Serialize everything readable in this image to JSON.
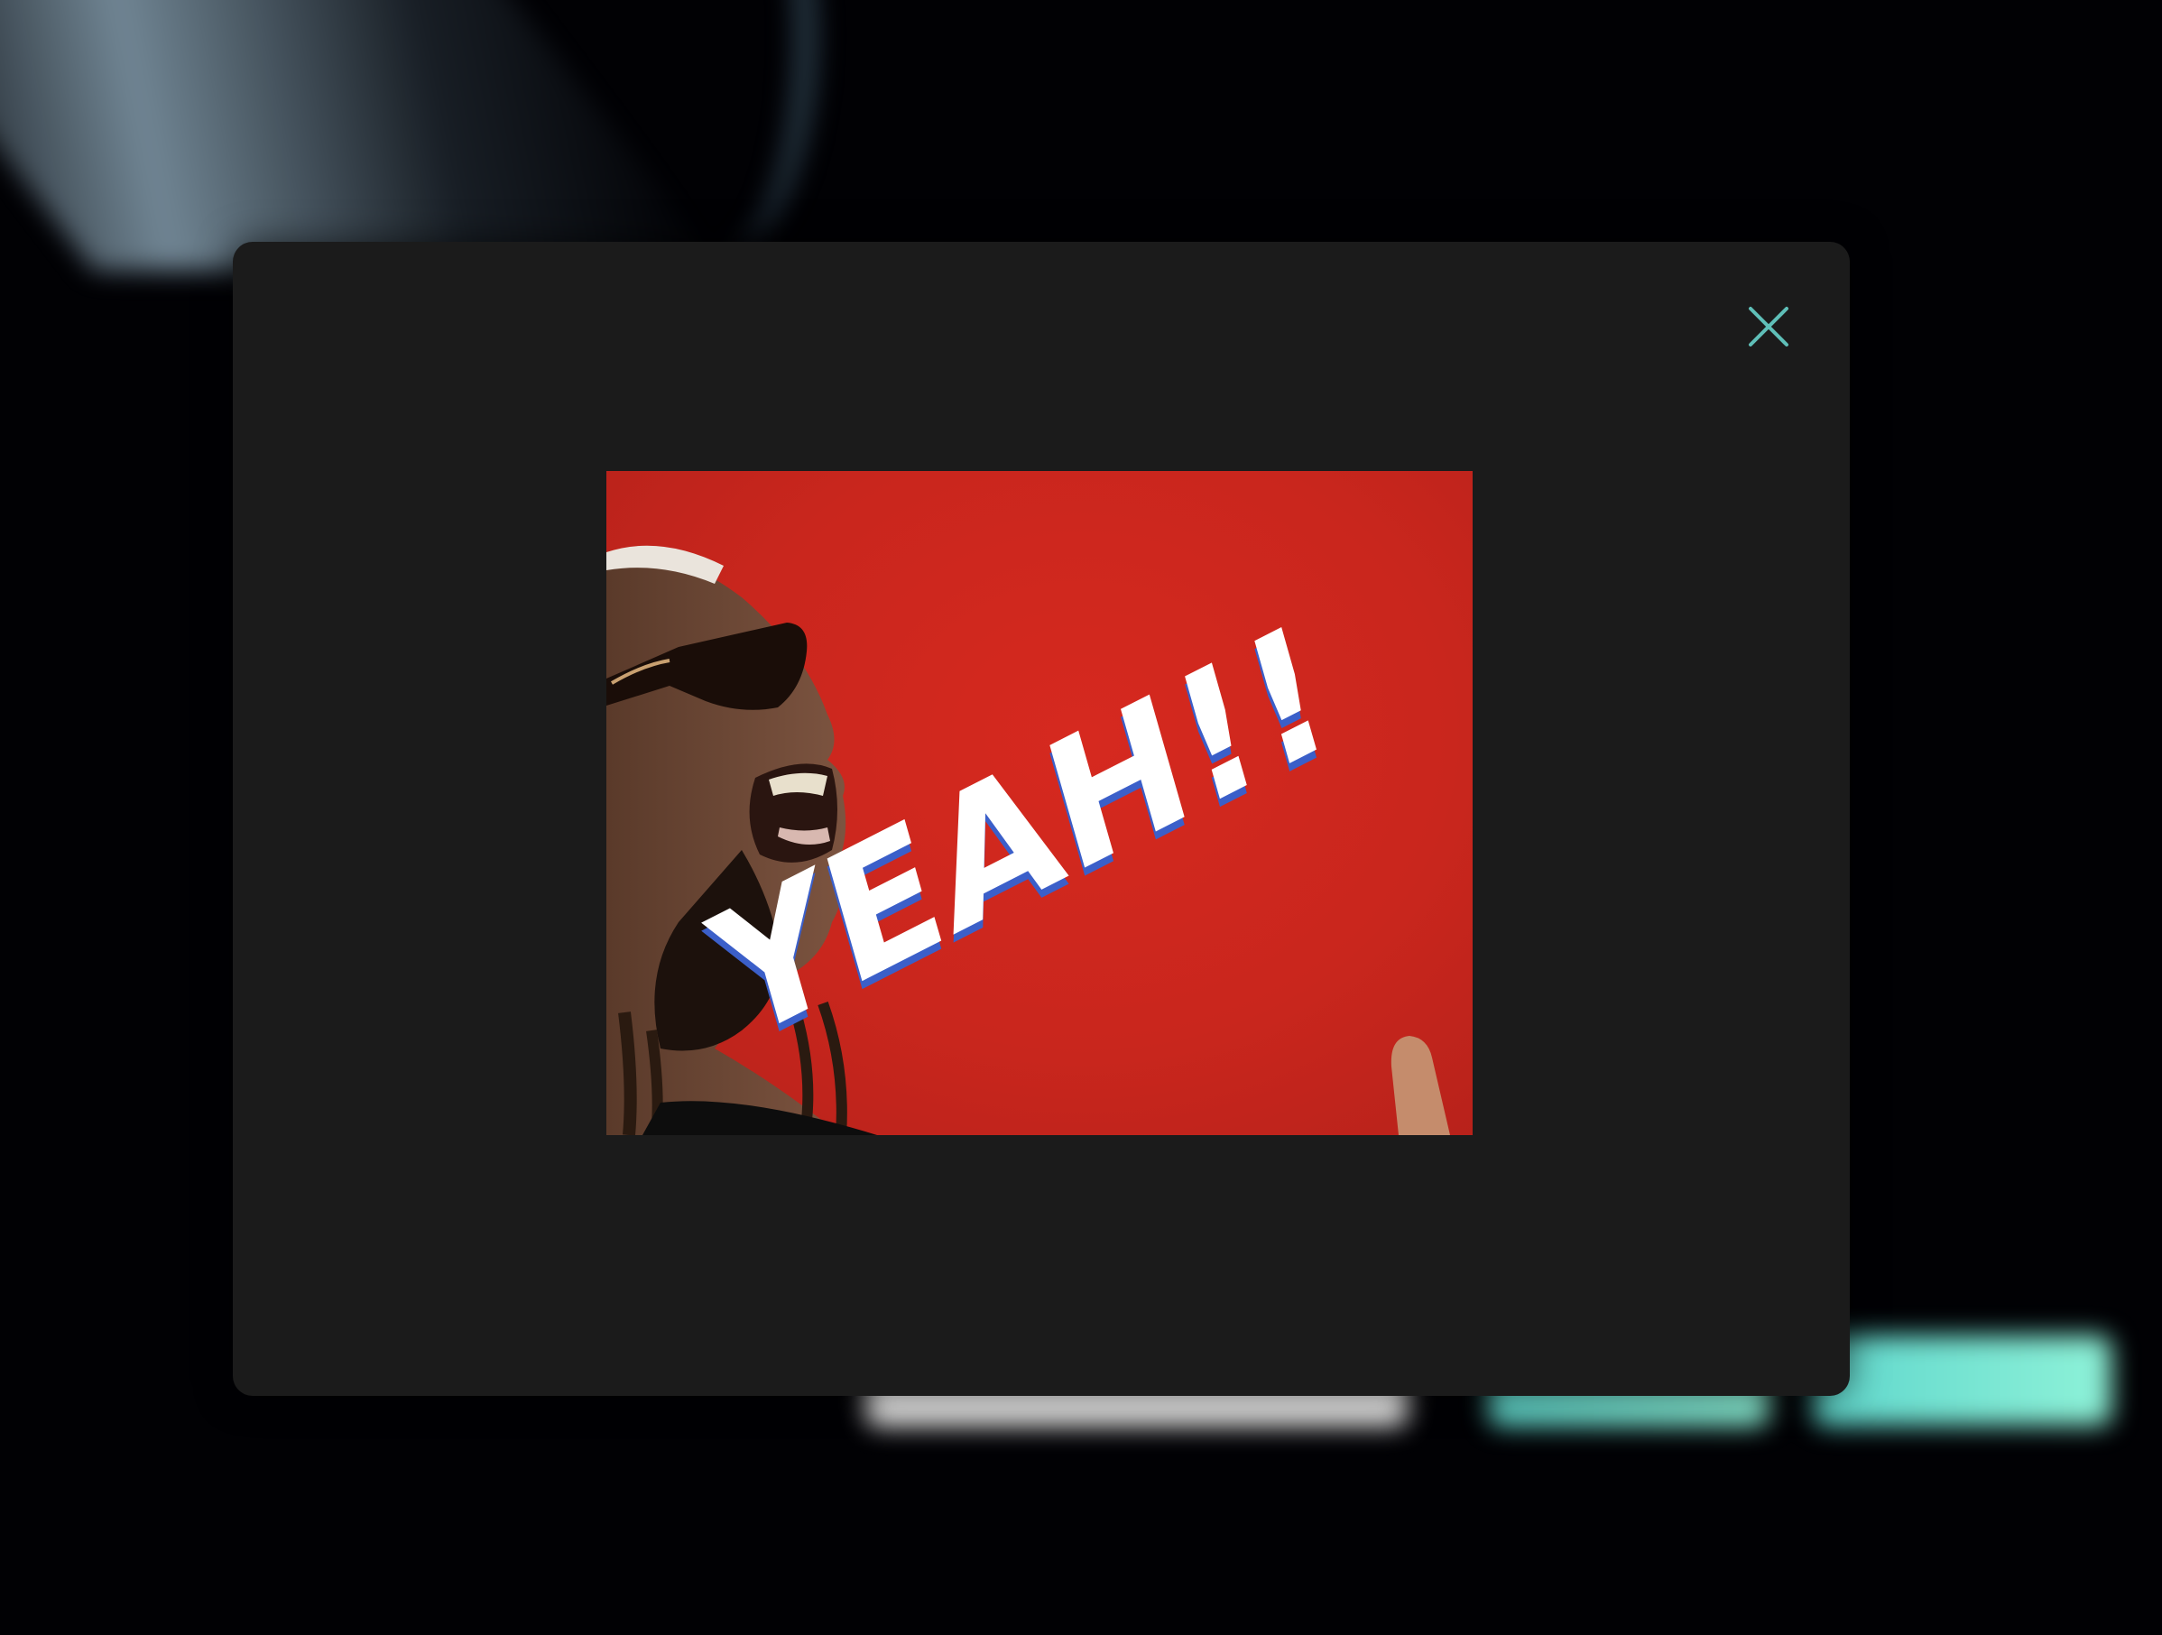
{
  "background": {
    "title": "",
    "lines": []
  },
  "modal": {
    "close_icon": "close-icon",
    "gif": {
      "caption": "YEAH!!",
      "background_color": "#c9261d",
      "text_color": "#ffffff",
      "shadow_color": "#3b5fc9"
    }
  },
  "colors": {
    "modal_background": "#1b1b1b",
    "accent": "#5fbfb8",
    "page_background": "#010104"
  }
}
